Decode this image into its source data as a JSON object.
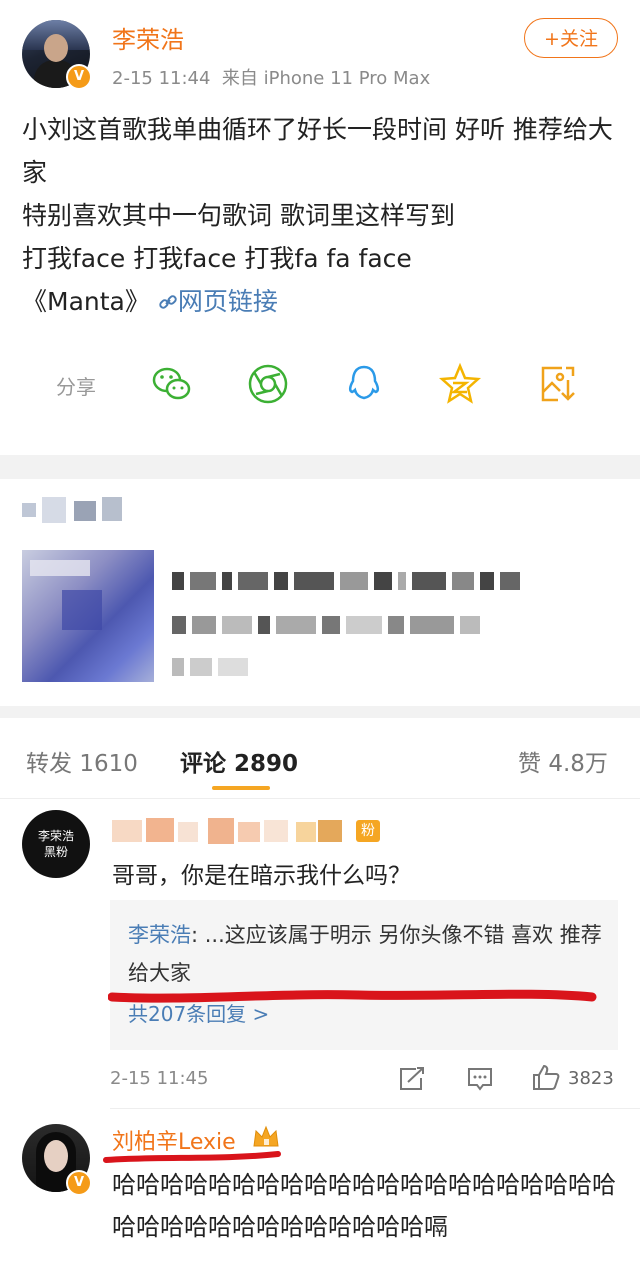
{
  "post": {
    "author": "李荣浩",
    "time": "2-15 11:44",
    "source": "来自 iPhone 11 Pro Max",
    "follow_label": "+关注",
    "lines": [
      "小刘这首歌我单曲循环了好长一段时间 好听 推荐给大家",
      "特别喜欢其中一句歌词 歌词里这样写到",
      "打我face 打我face 打我fa fa face"
    ],
    "title_line": "《Manta》",
    "link_label": "网页链接",
    "link_icon": "link-icon"
  },
  "share": {
    "label": "分享",
    "icons": [
      "wechat-icon",
      "moments-icon",
      "qq-icon",
      "qzone-icon",
      "save-image-icon"
    ]
  },
  "tabs": {
    "repost_label": "转发",
    "repost_count": "1610",
    "comment_label": "评论",
    "comment_count": "2890",
    "like_label": "赞",
    "like_count": "4.8万"
  },
  "comments": [
    {
      "avatar_text_1": "李荣浩",
      "avatar_text_2": "黑粉",
      "fan_badge": "粉",
      "text": "哥哥，你是在暗示我什么吗？",
      "reply_author": "李荣浩",
      "reply_text": ": ...这应该属于明示 另你头像不错 喜欢 推荐给大家",
      "reply_more": "共207条回复 >",
      "time": "2-15 11:45",
      "like_count": "3823"
    },
    {
      "name": "刘柏辛Lexie",
      "text": "哈哈哈哈哈哈哈哈哈哈哈哈哈哈哈哈哈哈哈哈哈哈哈哈哈哈哈哈哈哈哈哈哈哈嗝"
    }
  ],
  "colors": {
    "accent_orange": "#f1751a",
    "link_blue": "#4a7db5",
    "tab_underline": "#f5a623",
    "highlight_red": "#d9141b"
  }
}
